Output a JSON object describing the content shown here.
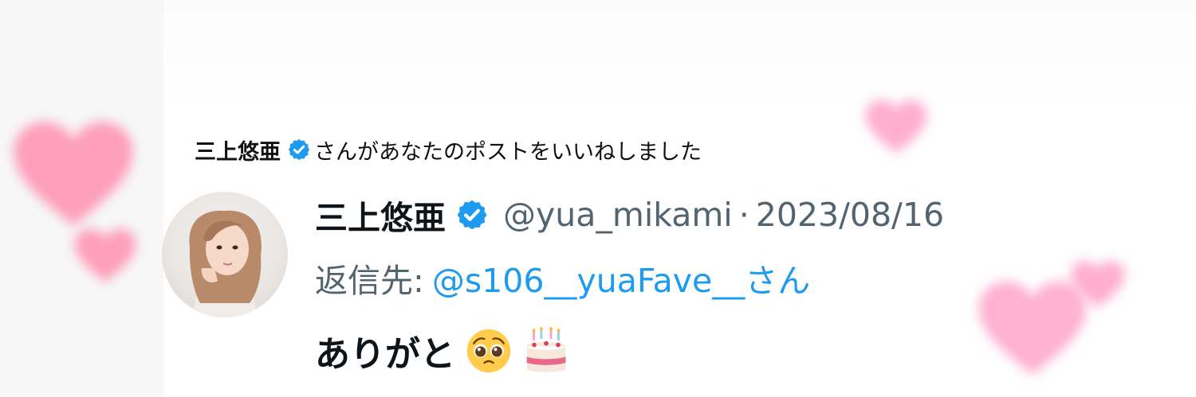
{
  "notification": {
    "actor": "三上悠亜",
    "message": "さんがあなたのポストをいいねしました"
  },
  "post": {
    "display_name": "三上悠亜",
    "handle": "@yua_mikami",
    "separator": "·",
    "date": "2023/08/16",
    "reply_label": "返信先:",
    "reply_target": "@s106__yuaFave__さん",
    "text": "ありがと"
  },
  "icons": {
    "verified": "verified-badge-icon",
    "emoji_1": "pleading-face-emoji",
    "emoji_2": "birthday-cake-emoji",
    "decor": "heart-icon"
  },
  "colors": {
    "verified": "#1d9bf0",
    "link": "#1d9bf0",
    "muted": "#536471",
    "heart": "#ff8fb8"
  }
}
